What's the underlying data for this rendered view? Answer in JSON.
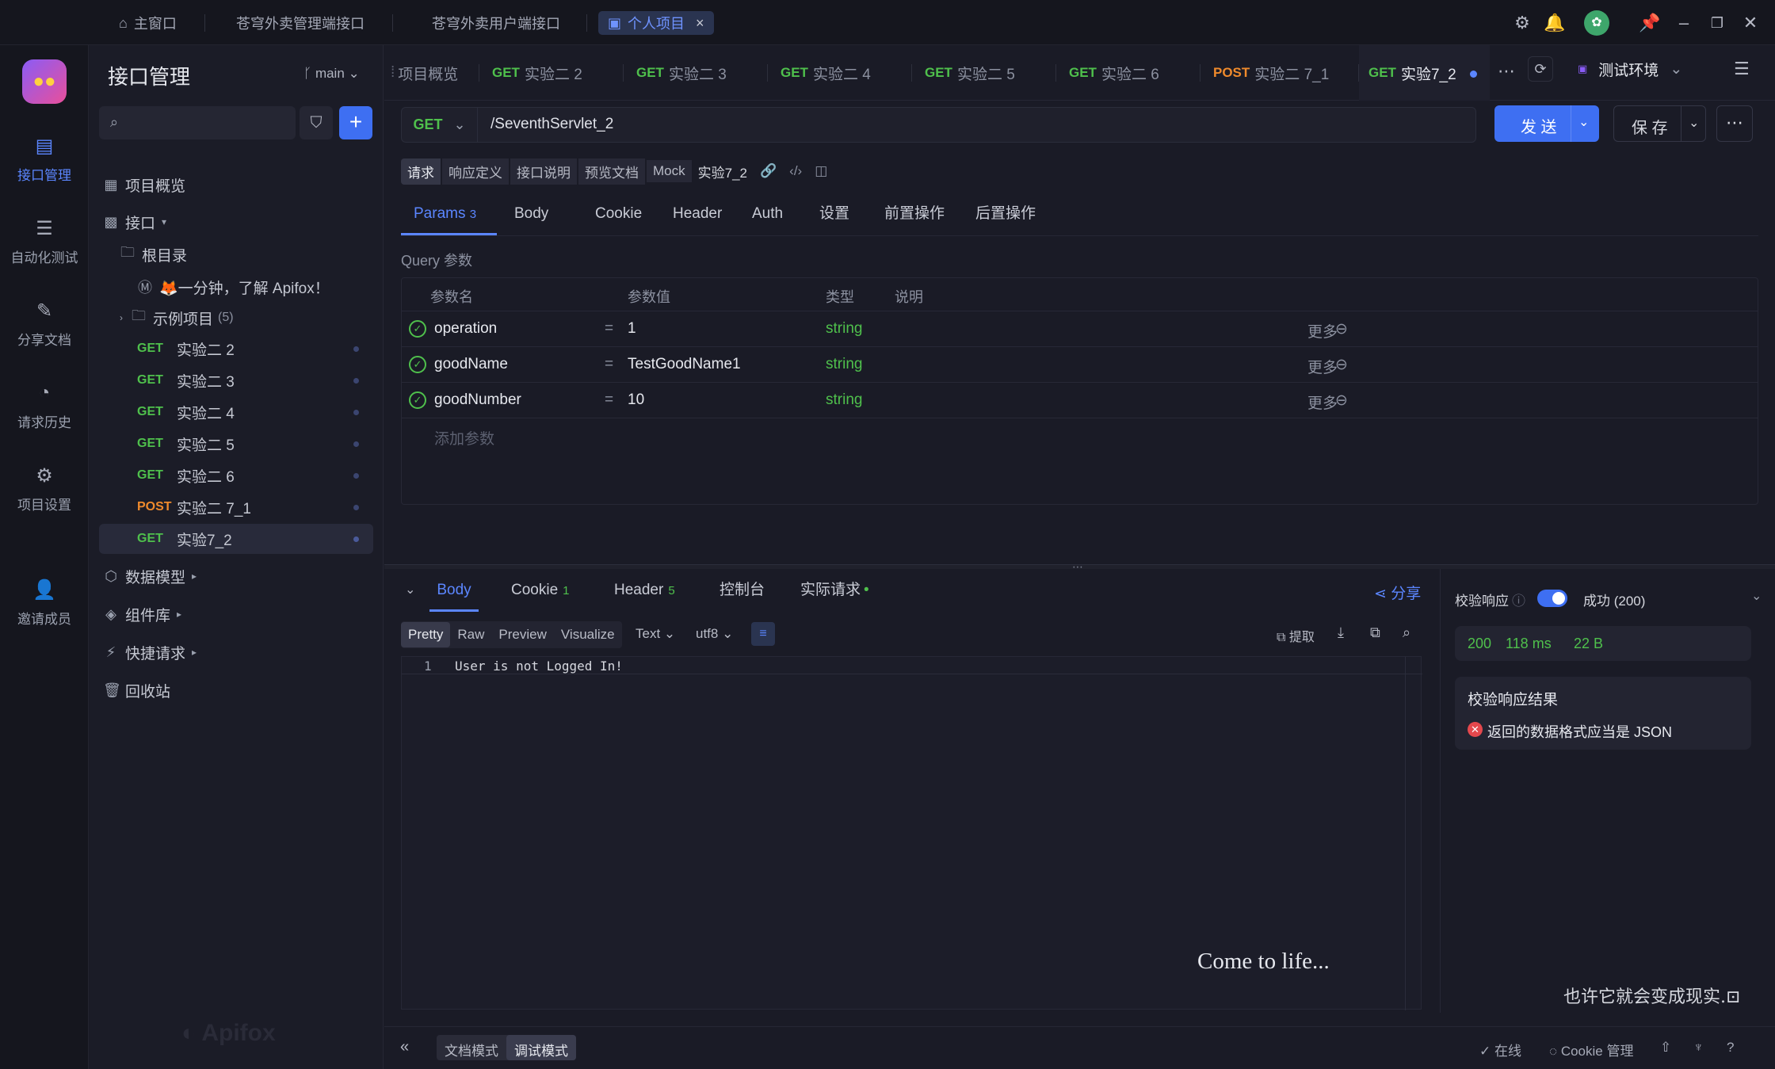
{
  "window_tabs": [
    {
      "label": "主窗口",
      "icon": "home-icon"
    },
    {
      "label": "苍穹外卖管理端接口"
    },
    {
      "label": "苍穹外卖用户端接口"
    },
    {
      "label": "个人项目",
      "active": true
    }
  ],
  "rail": [
    {
      "label": "接口管理",
      "icon": "api-icon",
      "active": true
    },
    {
      "label": "自动化测试",
      "icon": "automation-icon"
    },
    {
      "label": "分享文档",
      "icon": "share-doc-icon"
    },
    {
      "label": "请求历史",
      "icon": "history-icon"
    },
    {
      "label": "项目设置",
      "icon": "project-settings-icon"
    },
    {
      "label": "邀请成员",
      "icon": "invite-icon"
    }
  ],
  "sidebar": {
    "title": "接口管理",
    "branch": "main",
    "overview": "项目概览",
    "interfaces": "接口",
    "root": "根目录",
    "intro_doc": "🦊一分钟，了解 Apifox！",
    "example_folder": "示例项目",
    "example_count": "(5)",
    "apis": [
      {
        "method": "GET",
        "name": "实验二 2"
      },
      {
        "method": "GET",
        "name": "实验二 3"
      },
      {
        "method": "GET",
        "name": "实验二 4"
      },
      {
        "method": "GET",
        "name": "实验二 5"
      },
      {
        "method": "GET",
        "name": "实验二 6"
      },
      {
        "method": "POST",
        "name": "实验二 7_1"
      },
      {
        "method": "GET",
        "name": "实验7_2",
        "selected": true
      }
    ],
    "data_model": "数据模型",
    "components": "组件库",
    "quick_request": "快捷请求",
    "recycle": "回收站",
    "watermark": "Apifox"
  },
  "request_tabs": [
    {
      "label": "项目概览"
    },
    {
      "method": "GET",
      "name": "实验二 2"
    },
    {
      "method": "GET",
      "name": "实验二 3"
    },
    {
      "method": "GET",
      "name": "实验二 4"
    },
    {
      "method": "GET",
      "name": "实验二 5"
    },
    {
      "method": "GET",
      "name": "实验二 6"
    },
    {
      "method": "POST",
      "name": "实验二 7_1"
    },
    {
      "method": "GET",
      "name": "实验7_2",
      "active": true
    }
  ],
  "environment": "测试环境",
  "request": {
    "method": "GET",
    "url": "/SeventhServlet_2",
    "send": "发 送",
    "save": "保 存",
    "chips": [
      "请求",
      "响应定义",
      "接口说明",
      "预览文档",
      "Mock"
    ],
    "name": "实验7_2"
  },
  "param_tabs": [
    {
      "label": "Params",
      "count": "3",
      "active": true
    },
    {
      "label": "Body"
    },
    {
      "label": "Cookie"
    },
    {
      "label": "Header"
    },
    {
      "label": "Auth"
    },
    {
      "label": "设置"
    },
    {
      "label": "前置操作"
    },
    {
      "label": "后置操作"
    }
  ],
  "query": {
    "label": "Query 参数",
    "headers": [
      "参数名",
      "参数值",
      "类型",
      "说明"
    ],
    "rows": [
      {
        "name": "operation",
        "value": "1",
        "type": "string",
        "more": "更多"
      },
      {
        "name": "goodName",
        "value": "TestGoodName1",
        "type": "string",
        "more": "更多"
      },
      {
        "name": "goodNumber",
        "value": "10",
        "type": "string",
        "more": "更多"
      }
    ],
    "add_placeholder": "添加参数",
    "eq": "="
  },
  "response": {
    "tabs": [
      {
        "label": "Body",
        "active": true
      },
      {
        "label": "Cookie",
        "count": "1"
      },
      {
        "label": "Header",
        "count": "5"
      },
      {
        "label": "控制台"
      },
      {
        "label": "实际请求"
      }
    ],
    "share": "分享",
    "formats": [
      "Pretty",
      "Raw",
      "Preview",
      "Visualize"
    ],
    "type_select": "Text",
    "encoding_select": "utf8",
    "extract": "提取",
    "line_no": "1",
    "body": "User is not Logged In!",
    "overlay_text": "Come to life...",
    "validate_label": "校验响应",
    "status_select": "成功 (200)",
    "status_code": "200",
    "time": "118 ms",
    "size": "22 B",
    "result_title": "校验响应结果",
    "result_error": "返回的数据格式应当是 JSON",
    "poem": "也许它就会变成现实."
  },
  "bottom": {
    "doc_mode": "文档模式",
    "debug_mode": "调试模式",
    "online": "在线",
    "cookie_mgr": "Cookie 管理"
  },
  "colors": {
    "accent": "#3e6ff2",
    "get": "#4fc04c",
    "post": "#ef8a2c",
    "error": "#e5484d"
  }
}
